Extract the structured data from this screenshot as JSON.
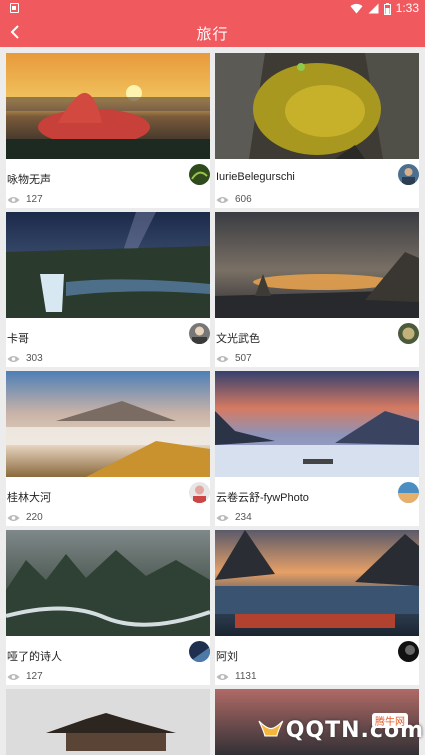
{
  "status_bar": {
    "time": "1:33"
  },
  "header": {
    "title": "旅行"
  },
  "cards": [
    {
      "author": "咏物无声",
      "views": "127"
    },
    {
      "author": "IurieBelegurschi",
      "views": "606"
    },
    {
      "author": "卡哥",
      "views": "303"
    },
    {
      "author": "文光武色",
      "views": "507"
    },
    {
      "author": "桂林大河",
      "views": "220"
    },
    {
      "author": "云卷云舒-fywPhoto",
      "views": "234"
    },
    {
      "author": "哑了的诗人",
      "views": "127"
    },
    {
      "author": "阿刘",
      "views": "1131"
    }
  ],
  "watermark": {
    "text": "QQTN.com",
    "cn": "腾牛网"
  },
  "colors": {
    "accent": "#f0595e",
    "background": "#ececec"
  },
  "icons": [
    "back-arrow-icon",
    "eye-icon",
    "wifi-icon",
    "signal-icon",
    "battery-icon"
  ]
}
